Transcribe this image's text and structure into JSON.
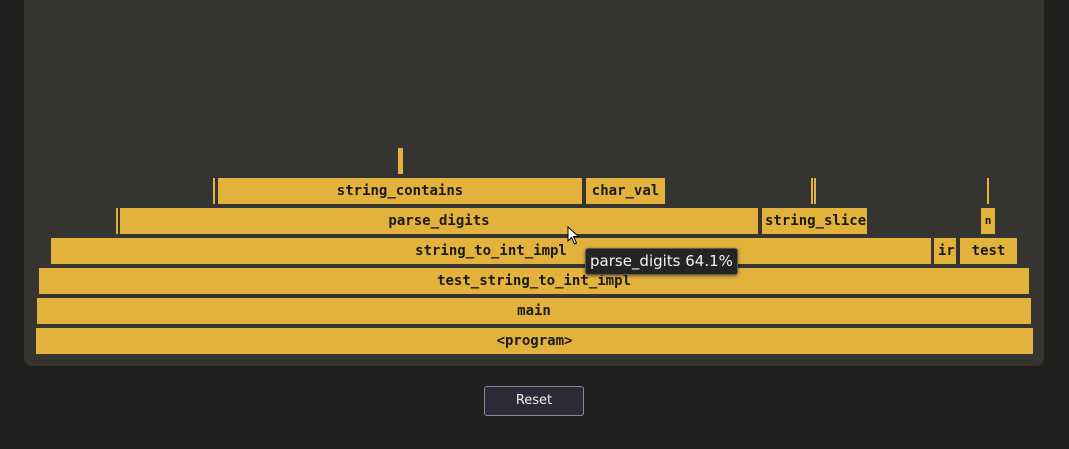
{
  "flamegraph": {
    "frames": {
      "program": "<program>",
      "main": "main",
      "test_string_to_int_impl": "test_string_to_int_impl",
      "string_to_int_impl": "string_to_int_impl",
      "ir": "ir",
      "test": "test",
      "parse_digits": "parse_digits",
      "string_slice": "string_slice",
      "n": "n",
      "string_contains": "string_contains",
      "char_val": "char_val"
    },
    "highlight_color": "#e3b23c",
    "background_color": "#363431"
  },
  "tooltip": {
    "text": "parse_digits 64.1%"
  },
  "controls": {
    "reset_label": "Reset"
  }
}
